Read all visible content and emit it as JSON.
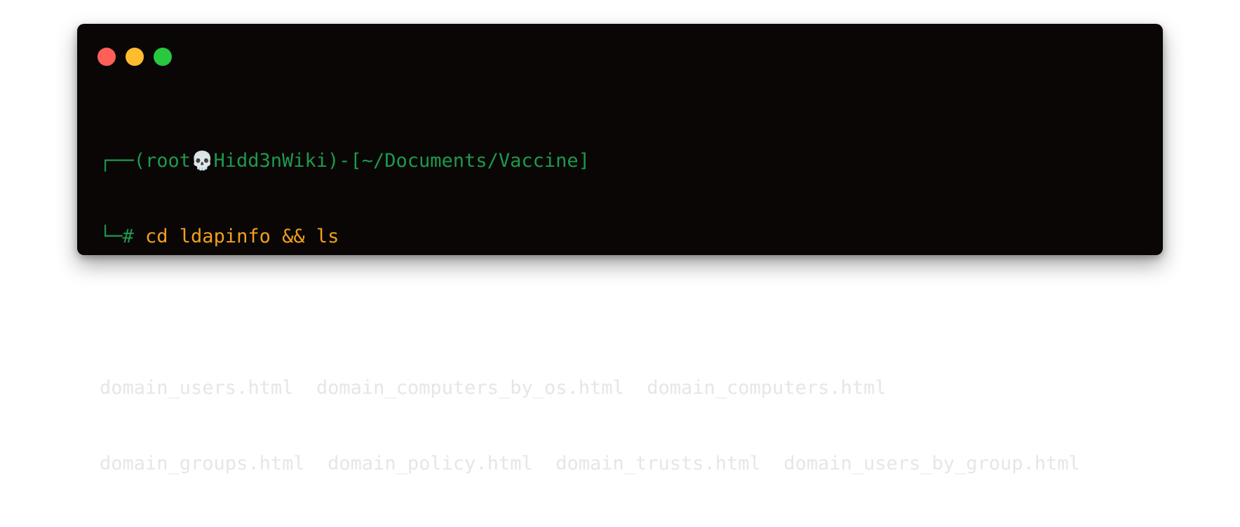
{
  "window": {
    "traffic_lights": [
      {
        "name": "close",
        "color": "#ff5f57"
      },
      {
        "name": "minimize",
        "color": "#febc2e"
      },
      {
        "name": "maximize",
        "color": "#28c840"
      }
    ],
    "background_color": "#0a0606"
  },
  "prompt": {
    "box_top": "┌──",
    "user": "(root",
    "skull": "💀",
    "host": "Hidd3nWiki)-[~/Documents/Vaccine]",
    "box_bottom": "└─",
    "hash": "# ",
    "command": "cd ldapinfo && ls",
    "prompt_color": "#1c9a4c",
    "command_color": "#f0a01e"
  },
  "output": {
    "line1": "domain_users.html  domain_computers_by_os.html  domain_computers.html",
    "line2": "domain_groups.html  domain_policy.html  domain_trusts.html  domain_users_by_group.html"
  }
}
